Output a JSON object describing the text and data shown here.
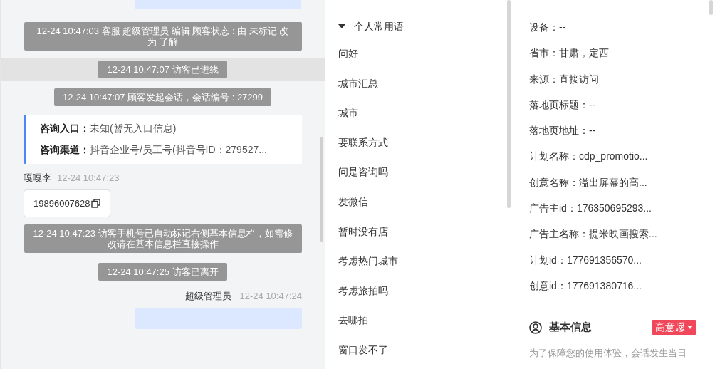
{
  "chat": {
    "messages": [
      {
        "kind": "notice",
        "text": "12-24 10:47:03 客服 超级管理员 编辑 顾客状态 : 由 未标记 改为 了解",
        "selected": false
      },
      {
        "kind": "notice",
        "text": "12-24 10:47:07 访客已进线",
        "selected": true
      },
      {
        "kind": "notice",
        "text": "12-24 10:47:07 顾客发起会话，会话编号 : 27299",
        "selected": false
      },
      {
        "kind": "info",
        "rows": [
          {
            "label": "咨询入口：",
            "value": "未知(暂无入口信息)"
          },
          {
            "label": "咨询渠道：",
            "value": "抖音企业号/员工号(抖音号ID：279527..."
          }
        ]
      },
      {
        "kind": "visitor",
        "name": "嘎嘎李",
        "time": "12-24 10:47:23",
        "text": "19896007628"
      },
      {
        "kind": "notice",
        "text": "12-24 10:47:23 访客手机号已自动标记右侧基本信息栏，如需修改请在基本信息栏直接操作",
        "selected": false
      },
      {
        "kind": "notice",
        "text": "12-24 10:47:25 访客已离开",
        "selected": false
      },
      {
        "kind": "agent",
        "name": "超级管理员",
        "time": "12-24 10:47:24"
      }
    ]
  },
  "phrases": {
    "group": "个人常用语",
    "expanded": true,
    "items": [
      "问好",
      "城市汇总",
      "城市",
      "要联系方式",
      "问是咨询吗",
      "发微信",
      "暂时没有店",
      "考虑热门城市",
      "考虑旅拍吗",
      "去哪拍",
      "窗口发不了"
    ]
  },
  "source": {
    "fields": [
      "设备：--",
      "省市：甘肃，定西",
      "来源：直接访问",
      "落地页标题：--",
      "落地页地址：--",
      "计划名称：cdp_promotio...",
      "创意名称：溢出屏幕的高...",
      "广告主id：176350695293...",
      "广告主名称：提米映画搜索...",
      "计划id：177691356570...",
      "创意id：177691380716..."
    ]
  },
  "basic": {
    "title": "基本信息",
    "intent": "高意愿",
    "note": "为了保障您的使用体验，会话发生当日"
  }
}
